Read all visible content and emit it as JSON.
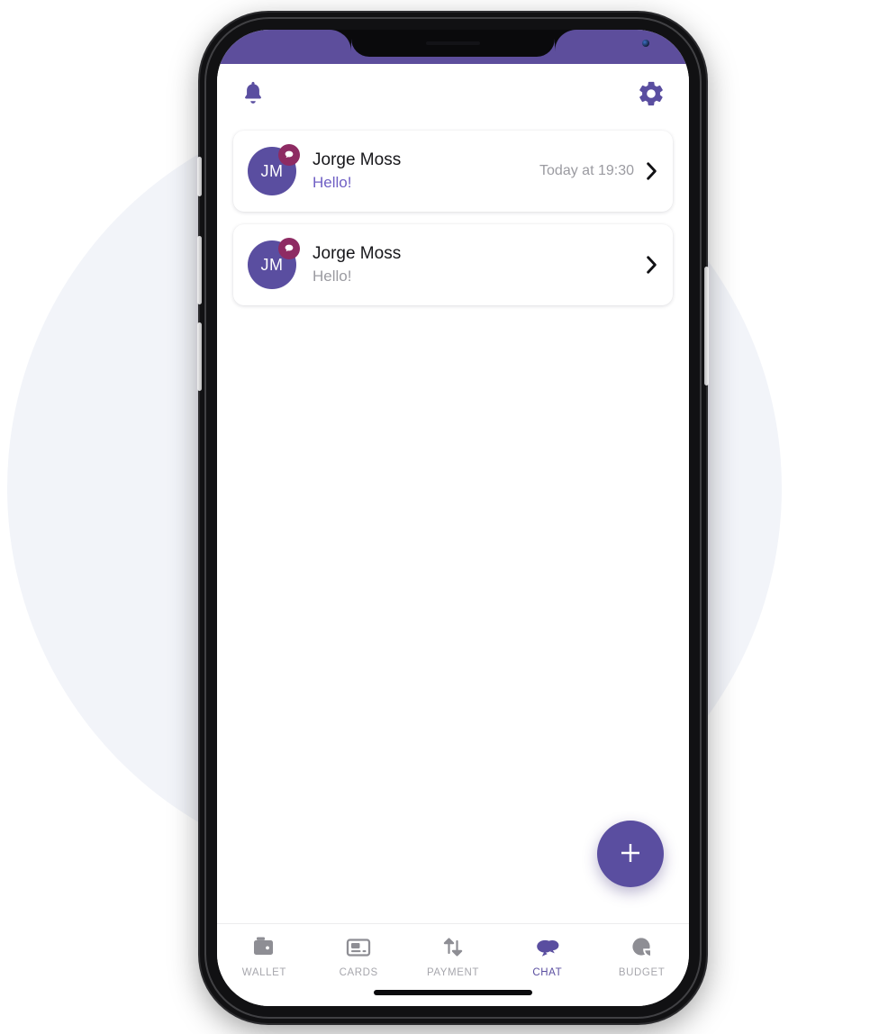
{
  "theme": {
    "brand_purple": "#5a4ea0",
    "status_bar_purple": "#5d4e9c",
    "accent_link": "#6f5fc4",
    "badge_maroon": "#8e2b63",
    "muted_gray": "#9b9ba1",
    "nav_inactive": "#a7a7ad",
    "screen_bg": "#ffffff",
    "blob_bg": "#f2f4f9",
    "device_body": "#111113"
  },
  "header": {
    "notifications_icon": "bell-icon",
    "settings_icon": "gear-icon"
  },
  "chats": [
    {
      "initials": "JM",
      "name": "Jorge Moss",
      "preview": "Hello!",
      "time": "Today at 19:30",
      "unread": true,
      "badge_icon": "chat-bubble-icon",
      "chevron_icon": "chevron-right-icon"
    },
    {
      "initials": "JM",
      "name": "Jorge Moss",
      "preview": "Hello!",
      "time": "",
      "unread": false,
      "badge_icon": "chat-bubble-icon",
      "chevron_icon": "chevron-right-icon"
    }
  ],
  "fab": {
    "label": "+",
    "icon": "plus-icon"
  },
  "bottom_nav": {
    "active": "CHAT",
    "items": [
      {
        "label": "WALLET",
        "icon": "wallet-icon",
        "active": false
      },
      {
        "label": "CARDS",
        "icon": "card-icon",
        "active": false
      },
      {
        "label": "PAYMENT",
        "icon": "transfer-arrows-icon",
        "active": false
      },
      {
        "label": "CHAT",
        "icon": "chat-bubbles-icon",
        "active": true
      },
      {
        "label": "BUDGET",
        "icon": "pie-chart-icon",
        "active": false
      }
    ]
  }
}
